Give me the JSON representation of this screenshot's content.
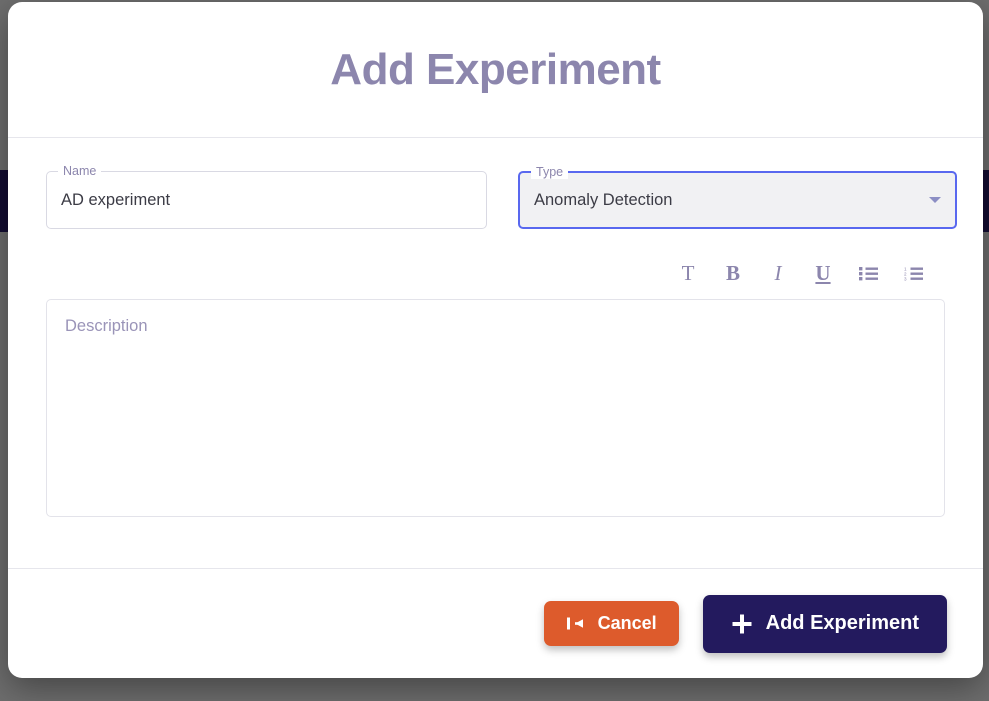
{
  "modal": {
    "title": "Add Experiment",
    "name_field": {
      "label": "Name",
      "value": "AD experiment",
      "placeholder": "Name"
    },
    "type_field": {
      "label": "Type",
      "value": "Anomaly Detection",
      "caret_icon": "chevron-down-icon",
      "focused": true
    },
    "editor": {
      "toolbar": [
        {
          "name": "text-style-icon",
          "glyph": "T"
        },
        {
          "name": "bold-icon",
          "glyph": "B"
        },
        {
          "name": "italic-icon",
          "glyph": "I"
        },
        {
          "name": "underline-icon",
          "glyph": "U"
        },
        {
          "name": "bulleted-list-icon",
          "glyph": ""
        },
        {
          "name": "numbered-list-icon",
          "glyph": ""
        }
      ],
      "description_placeholder": "Description",
      "description_value": ""
    },
    "footer": {
      "cancel_label": "Cancel",
      "cancel_icon": "back-to-start-icon",
      "submit_label": "Add Experiment",
      "submit_icon": "plus-icon"
    }
  },
  "colors": {
    "title": "#8c86ad",
    "focus_border": "#5968ef",
    "cancel_bg": "#dd5b2c",
    "submit_bg": "#231a5e",
    "backdrop": "#6e6e6e",
    "behind_navy": "#140d33"
  }
}
